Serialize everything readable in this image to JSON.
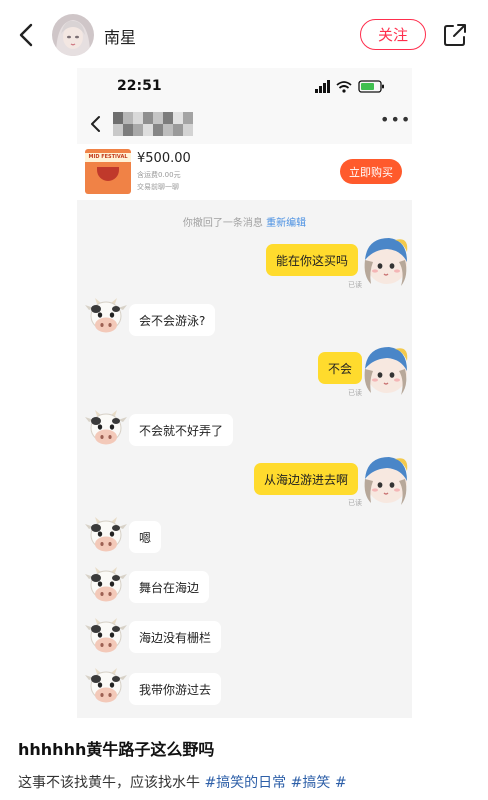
{
  "header": {
    "author_name": "南星",
    "follow_label": "关注"
  },
  "screenshot": {
    "status_time": "22:51",
    "chat_more": "•••",
    "product": {
      "thumb_text": "MID FESTIVAL",
      "price": "¥500.00",
      "shipping": "含运费0.00元",
      "trade_note": "交易前聊一聊",
      "buy_label": "立即购买"
    },
    "recall": {
      "text": "你撤回了一条消息",
      "edit_label": "重新编辑"
    },
    "read_label": "已读",
    "messages": [
      {
        "side": "right",
        "text": "能在你这买吗"
      },
      {
        "side": "left",
        "text": "会不会游泳?"
      },
      {
        "side": "right",
        "text": "不会"
      },
      {
        "side": "left",
        "text": "不会就不好弄了"
      },
      {
        "side": "right",
        "text": "从海边游进去啊"
      },
      {
        "side": "left",
        "text": "嗯"
      },
      {
        "side": "left",
        "text": "舞台在海边"
      },
      {
        "side": "left",
        "text": "海边没有栅栏"
      },
      {
        "side": "left",
        "text": "我带你游过去"
      }
    ]
  },
  "post": {
    "title": "hhhhhh黄牛路子这么野吗",
    "body": "这事不该找黄牛，应该找水牛",
    "tags": [
      "#搞笑的日常",
      "#搞笑",
      "#"
    ]
  },
  "colors": {
    "accent_red": "#ff2e4d",
    "buy_orange": "#ff5a2c",
    "bubble_yellow": "#ffdb2d",
    "link_blue": "#4a90e2",
    "tag_blue": "#2d5fa8"
  }
}
